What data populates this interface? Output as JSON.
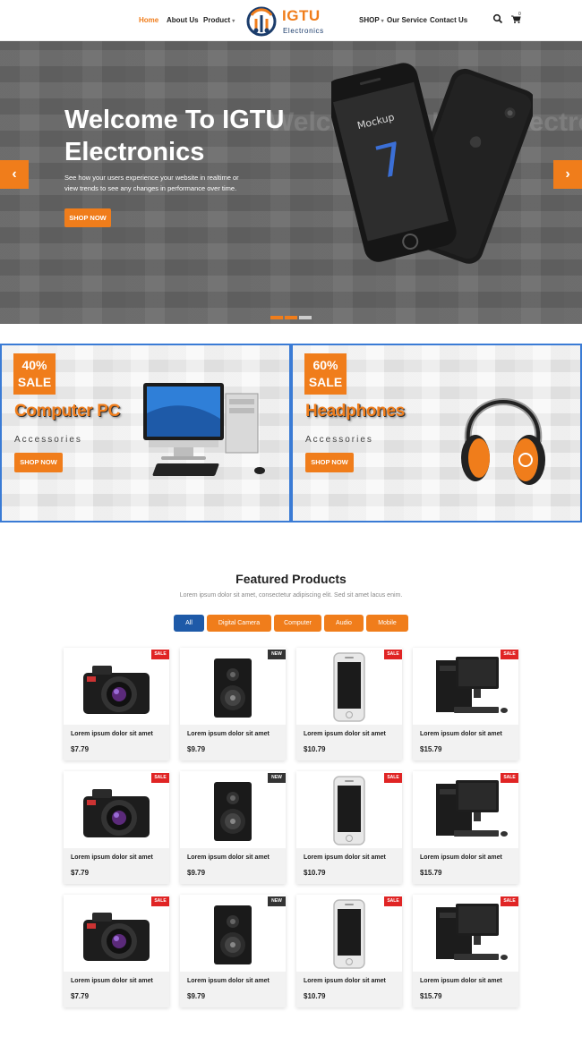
{
  "nav": {
    "items_left": [
      {
        "label": "Home"
      },
      {
        "label": "About Us"
      },
      {
        "label": "Product"
      }
    ],
    "items_right": [
      {
        "label": "SHOP"
      },
      {
        "label": "Our Service"
      },
      {
        "label": "Contact Us"
      }
    ],
    "logo_title": "IGTU",
    "logo_sub": "Electronics",
    "cart_count": "0",
    "icons": [
      "search-icon",
      "cart-icon"
    ]
  },
  "hero": {
    "title": "Welcome To IGTU Electronics",
    "text": "See how your users experience your website in realtime or view trends to see any changes in performance over time.",
    "button": "SHOP NOW",
    "ghost_text": "Welcome To IGTU Electronics",
    "phone_screen_text": "Mockup",
    "phone_number": "7"
  },
  "promos": [
    {
      "percent": "40%",
      "sale": "SALE",
      "title": "Computer PC",
      "subtitle": "Accessories",
      "button": "SHOP NOW"
    },
    {
      "percent": "60%",
      "sale": "SALE",
      "title": "Headphones",
      "subtitle": "Accessories",
      "button": "SHOP NOW"
    }
  ],
  "featured": {
    "title": "Featured Products",
    "subtitle": "Lorem ipsum dolor sit amet, consectetur adipiscing elit. Sed sit amet lacus enim.",
    "filters": [
      "All",
      "Digital Camera",
      "Computer",
      "Audio",
      "Mobile"
    ],
    "products": [
      {
        "name": "Lorem ipsum dolor sit amet",
        "price": "$7.79",
        "badge": "SALE",
        "icon": "camera-icon"
      },
      {
        "name": "Lorem ipsum dolor sit amet",
        "price": "$9.79",
        "badge": "NEW",
        "icon": "speaker-icon"
      },
      {
        "name": "Lorem ipsum dolor sit amet",
        "price": "$10.79",
        "badge": "SALE",
        "icon": "phone-icon"
      },
      {
        "name": "Lorem ipsum dolor sit amet",
        "price": "$15.79",
        "badge": "SALE",
        "icon": "desktop-icon"
      },
      {
        "name": "Lorem ipsum dolor sit amet",
        "price": "$7.79",
        "badge": "SALE",
        "icon": "camera-icon"
      },
      {
        "name": "Lorem ipsum dolor sit amet",
        "price": "$9.79",
        "badge": "NEW",
        "icon": "speaker-icon"
      },
      {
        "name": "Lorem ipsum dolor sit amet",
        "price": "$10.79",
        "badge": "SALE",
        "icon": "phone-icon"
      },
      {
        "name": "Lorem ipsum dolor sit amet",
        "price": "$15.79",
        "badge": "SALE",
        "icon": "desktop-icon"
      },
      {
        "name": "Lorem ipsum dolor sit amet",
        "price": "$7.79",
        "badge": "SALE",
        "icon": "camera-icon"
      },
      {
        "name": "Lorem ipsum dolor sit amet",
        "price": "$9.79",
        "badge": "NEW",
        "icon": "speaker-icon"
      },
      {
        "name": "Lorem ipsum dolor sit amet",
        "price": "$10.79",
        "badge": "SALE",
        "icon": "phone-icon"
      },
      {
        "name": "Lorem ipsum dolor sit amet",
        "price": "$15.79",
        "badge": "SALE",
        "icon": "desktop-icon"
      }
    ]
  },
  "colors": {
    "accent": "#f07d1b",
    "blue": "#1e5aa8",
    "sale": "#e02424",
    "new": "#333333"
  }
}
